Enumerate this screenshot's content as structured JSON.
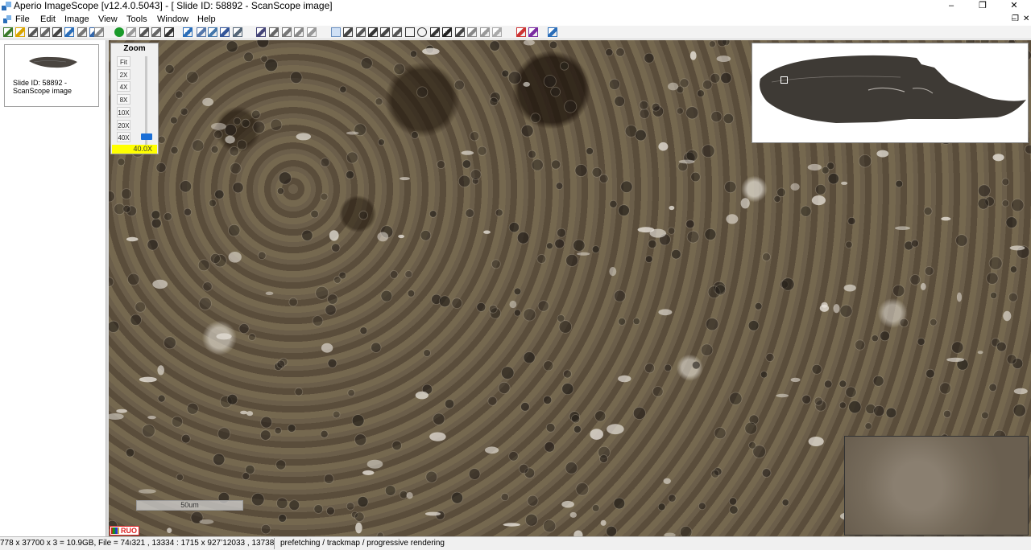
{
  "window": {
    "title": "Aperio ImageScope [v12.4.0.5043] - [ Slide ID: 58892  - ScanScope image]",
    "minimize_glyph": "–",
    "maximize_glyph": "❐",
    "close_glyph": "✕"
  },
  "menu": {
    "items": [
      "File",
      "Edit",
      "Image",
      "View",
      "Tools",
      "Window",
      "Help"
    ],
    "mdi_minimize": "–",
    "mdi_restore": "❐",
    "mdi_close": "✕"
  },
  "toolbar": {
    "icons": [
      "open-icon",
      "folder-icon",
      "print-icon",
      "camera-icon",
      "save-icon",
      "export-icon",
      "grid-icon",
      "properties-icon",
      "info-icon",
      "go-icon",
      "back-icon",
      "layers-icon",
      "compare-icon",
      "select-icon",
      "frame-icon",
      "overview-toggle-icon",
      "magnifier-toggle-icon",
      "zoom-icon",
      "fit-icon",
      "annotate-icon",
      "pen-icon",
      "brush-icon",
      "fill-icon",
      "erase-icon",
      "pan-icon",
      "region-icon",
      "snapshot-icon",
      "pointer-icon",
      "measure-icon",
      "ruler-icon",
      "rectangle-icon",
      "ellipse-icon",
      "arrow-icon",
      "grid-hash-icon",
      "table-icon",
      "link-icon",
      "copy-icon",
      "paste-icon",
      "color-icon",
      "levels-icon",
      "help-icon"
    ]
  },
  "slides_panel": {
    "caption": "Slide ID: 58892  - ScanScope image"
  },
  "zoom": {
    "title": "Zoom",
    "levels": [
      "Fit",
      "2X",
      "4X",
      "8X",
      "10X",
      "20X",
      "40X"
    ],
    "current": "40.0X",
    "accent": "#1b6fd6",
    "readout_color": "#ffff00"
  },
  "scalebar": {
    "label": "50um"
  },
  "badge": {
    "label": "RUO",
    "color": "#dd2222"
  },
  "status": {
    "left": "778 x 37700 x 3 = 10.9GB, File = 74ı321 , 13334 : 1715 x 927’12033 , 13738",
    "right": "prefetching / trackmap / progressive rendering"
  }
}
